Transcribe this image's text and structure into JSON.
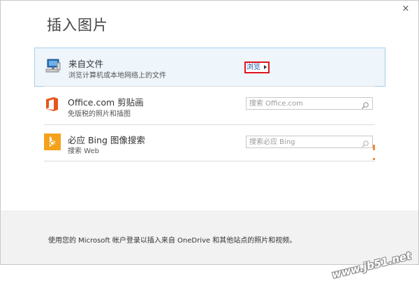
{
  "dialog": {
    "title": "插入图片",
    "close_label": "×"
  },
  "sources": [
    {
      "title": "来自文件",
      "subtitle": "浏览计算机或本地网络上的文件",
      "action_label": "浏览",
      "icon": "computer-icon"
    },
    {
      "title": "Office.com 剪贴画",
      "subtitle": "免版税的照片和插图",
      "search_placeholder": "搜索 Office.com",
      "icon": "office-logo-icon"
    },
    {
      "title": "必应 Bing 图像搜索",
      "subtitle": "搜索 Web",
      "search_placeholder": "搜索必应 Bing",
      "icon": "bing-logo-icon"
    }
  ],
  "footer": {
    "text": "使用您的 Microsoft 帐户登录以插入来自 OneDrive 和其他站点的照片和视频。"
  },
  "watermark": "www.jb51.net",
  "colors": {
    "selected_row_bg": "#eef5fb",
    "selected_row_border": "#a9cfe8",
    "office_orange": "#e8541a",
    "bing_orange": "#f4a21b",
    "highlight_red": "#e0141e"
  }
}
